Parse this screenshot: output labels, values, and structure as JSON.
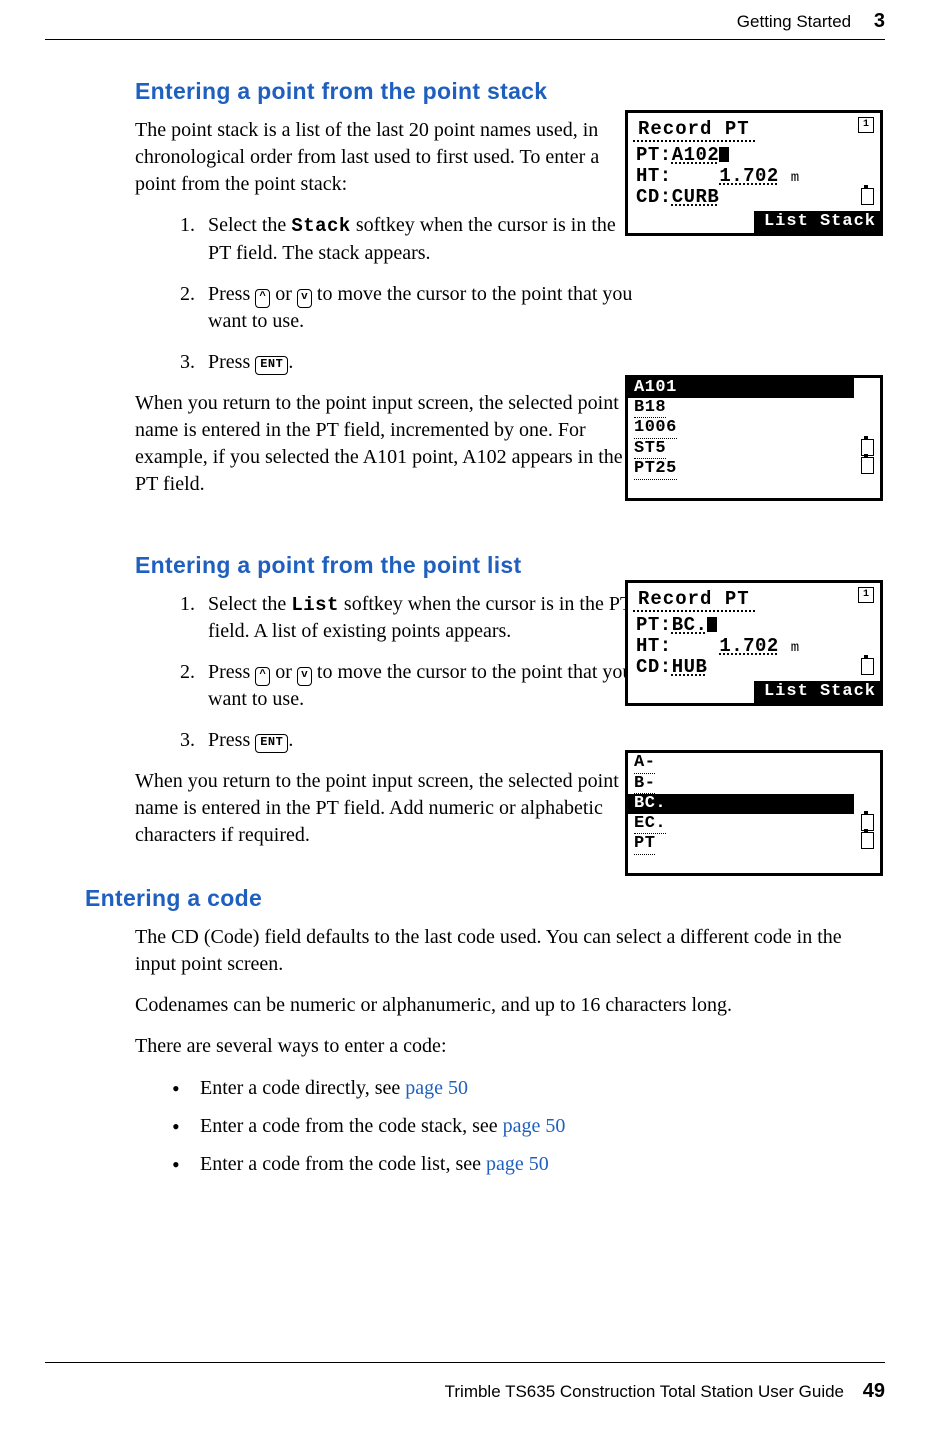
{
  "header": {
    "section": "Getting Started",
    "chapter": "3"
  },
  "footer": {
    "guide": "Trimble TS635 Construction Total Station User Guide",
    "page": "49"
  },
  "s1": {
    "title": "Entering a point from the point stack",
    "intro": "The point stack is a list of the last 20 point names used, in chronological order from last used to first used. To enter a point from the point stack:",
    "step1a": "Select the ",
    "softkey": "Stack",
    "step1b": " softkey when the cursor is in the PT field. The stack appears.",
    "step2a": "Press ",
    "up": "^",
    "or": " or ",
    "down": "v",
    "step2b": " to move the cursor to the point that you want to use.",
    "step3a": "Press ",
    "ent": "ENT",
    "step3b": ".",
    "outro": "When you return to the point input screen, the selected point name is entered in the PT field, incremented by one. For example, if you selected the A101 point, A102 appears in the PT field."
  },
  "lcd1": {
    "title": "Record PT",
    "pt_label": "PT:",
    "pt_value": "A102",
    "ht_label": "HT:",
    "ht_value": "1.702",
    "ht_unit": "m",
    "cd_label": "CD:",
    "cd_value": "CURB",
    "soft": "List Stack",
    "ind": "1"
  },
  "lcd2": {
    "items": [
      "A101",
      "B18",
      "1006",
      "ST5",
      "PT25"
    ]
  },
  "s2": {
    "title": "Entering a point from the point list",
    "step1a": "Select the ",
    "softkey": "List",
    "step1b": " softkey when the cursor is in the PT field. A list of existing points appears.",
    "step2a": "Press ",
    "up": "^",
    "or": " or ",
    "down": "v",
    "step2b": " to move the cursor to the point that you want to use.",
    "step3a": "Press ",
    "ent": "ENT",
    "step3b": ".",
    "outro": "When you return to the point input screen, the selected point name is entered in the PT field. Add numeric or alphabetic characters if required."
  },
  "lcd3": {
    "title": "Record PT",
    "pt_label": "PT:",
    "pt_value": "BC.",
    "ht_label": "HT:",
    "ht_value": "1.702",
    "ht_unit": "m",
    "cd_label": "CD:",
    "cd_value": "HUB",
    "soft": "List Stack",
    "ind": "1"
  },
  "lcd4": {
    "items": [
      "A-",
      "B-",
      "BC.",
      "EC.",
      "PT"
    ]
  },
  "s3": {
    "title": "Entering a code",
    "p1": "The CD (Code) field defaults to the last code used. You can select a different code in the input point screen.",
    "p2": "Codenames can be numeric or alphanumeric, and up to 16 characters long.",
    "p3": "There are several ways to enter a code:",
    "b1a": "Enter a code directly, see ",
    "b1link": "page 50",
    "b2a": "Enter a code from the code stack, see ",
    "b2link": "page 50",
    "b3a": "Enter a code from the code list, see ",
    "b3link": "page 50"
  }
}
